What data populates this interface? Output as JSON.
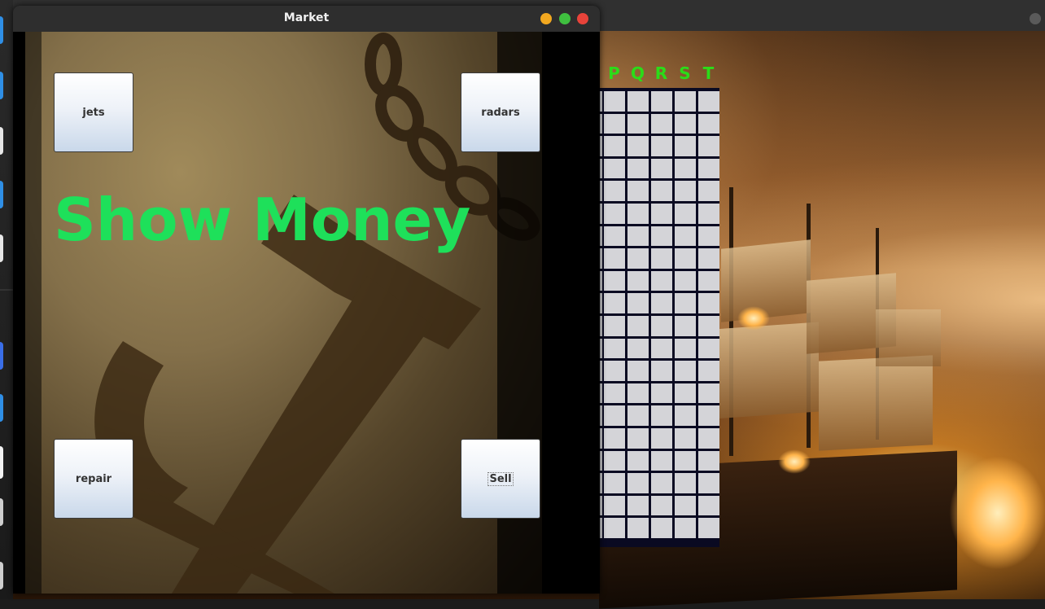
{
  "market_window": {
    "title": "Market",
    "buttons": {
      "jets": "jets",
      "radars": "radars",
      "repair": "repair",
      "sell": "Sell"
    },
    "money_label": "Show Money",
    "money_color": "#1ee05a"
  },
  "window_controls": {
    "minimize_color": "#f2a820",
    "maximize_color": "#3fbf3f",
    "close_color": "#e8433a"
  },
  "board": {
    "column_headers": [
      "P",
      "Q",
      "R",
      "S",
      "T"
    ],
    "header_color": "#2bdc19",
    "rows": 20
  },
  "dock": {
    "app_colors": [
      "#2f8fe6",
      "#2f8fe6",
      "#ffffff",
      "#2f8fe6",
      "#ffffff",
      "#2f8fe6",
      "#2f8fe6",
      "#ffffff"
    ]
  }
}
